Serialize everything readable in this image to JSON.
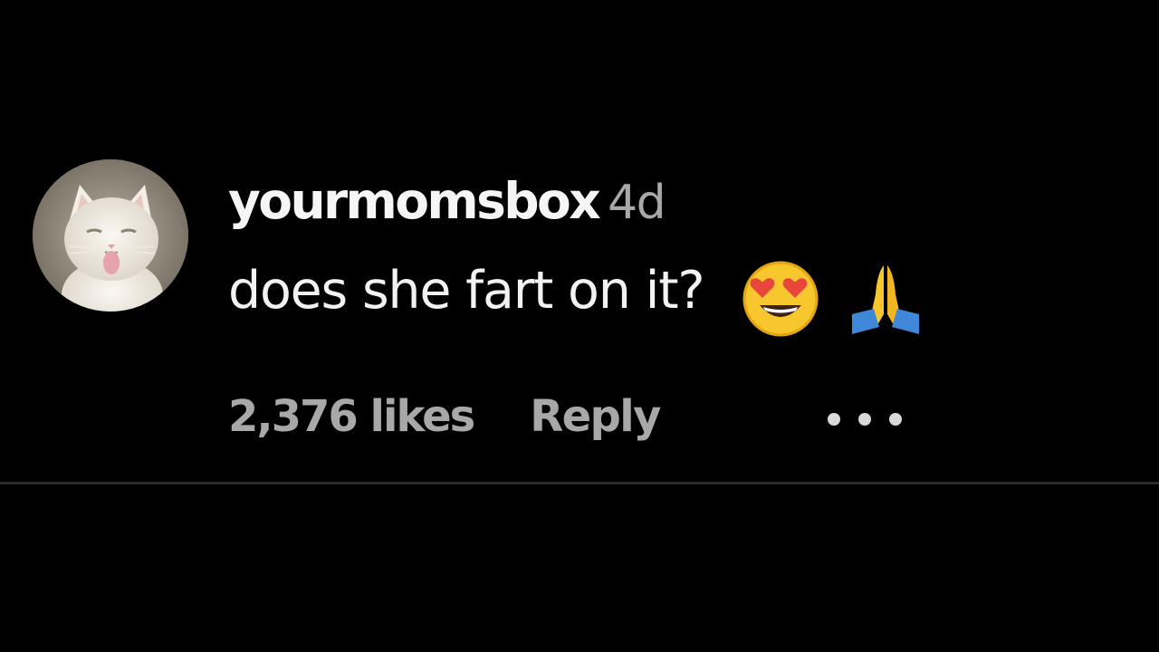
{
  "comment": {
    "username": "yourmomsbox",
    "timestamp": "4d",
    "text": "does she fart on it?",
    "emojis": [
      "smiling-face-with-heart-eyes",
      "folded-hands"
    ],
    "likes": "2,376 likes",
    "reply_label": "Reply",
    "more_icon": "more-options-icon",
    "avatar": "cat-tongue-avatar"
  },
  "colors": {
    "background": "#000000",
    "primary_text": "#f2f2f2",
    "secondary_text": "#a8a8a8",
    "divider": "#2b2b2b"
  }
}
